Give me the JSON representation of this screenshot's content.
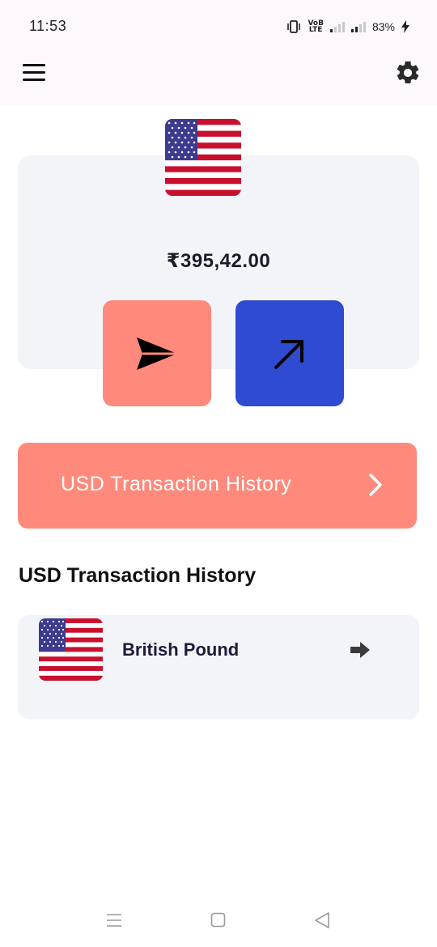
{
  "status_bar": {
    "time": "11:53",
    "network_label_top": "VoB",
    "network_label_bottom": "LTE",
    "battery": "83%",
    "icons": [
      "vibrate-icon",
      "volte-icon",
      "signal-icon",
      "signal-icon",
      "charging-bolt-icon"
    ]
  },
  "app_bar": {
    "icons": [
      "hamburger-menu-icon",
      "gear-icon"
    ]
  },
  "wallet": {
    "flag": "us-flag-icon",
    "balance": "₹395,42.00",
    "send_icon": "send-icon",
    "receive_icon": "arrow-up-right-icon"
  },
  "history_banner": {
    "label": "USD Transaction History",
    "icon": "chevron-right-icon"
  },
  "section": {
    "title": "USD Transaction History"
  },
  "currencies": [
    {
      "name": "British Pound",
      "flag": "us-flag-icon",
      "icon": "arrow-right-icon"
    }
  ],
  "colors": {
    "accent_coral": "#ff8a7c",
    "accent_blue": "#2e4bd1",
    "card_background": "#f3f4f8",
    "app_bar_background": "#fdf8fc"
  },
  "nav_bar": {
    "icons": [
      "nav-menu-icon",
      "nav-home-icon",
      "nav-back-icon"
    ]
  }
}
